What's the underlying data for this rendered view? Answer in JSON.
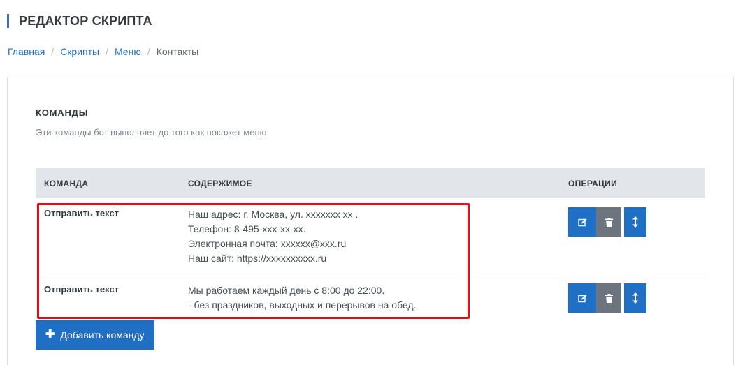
{
  "header": {
    "title": "РЕДАКТОР СКРИПТА"
  },
  "breadcrumb": {
    "items": [
      "Главная",
      "Скрипты",
      "Меню"
    ],
    "current": "Контакты",
    "separator": "/"
  },
  "section": {
    "title": "КОМАНДЫ",
    "description": "Эти команды бот выполняет до того как покажет меню."
  },
  "table": {
    "columns": {
      "command": "КОМАНДА",
      "content": "СОДЕРЖИМОЕ",
      "operations": "ОПЕРАЦИИ"
    },
    "rows": [
      {
        "command": "Отправить текст",
        "lines": [
          "Наш адрес: г. Москва, ул. xxxxxxx xx .",
          "Телефон: 8-495-xxx-xx-xx.",
          "Электронная почта: xxxxxx@xxx.ru",
          "Наш сайт: https://xxxxxxxxxx.ru"
        ]
      },
      {
        "command": "Отправить текст",
        "lines": [
          "Мы работаем каждый день с 8:00 до 22:00.",
          "- без праздников, выходных и перерывов на обед."
        ]
      }
    ],
    "operation_icons": [
      "edit-icon",
      "trash-icon",
      "move-vertical-icon"
    ]
  },
  "actions": {
    "add_label": "Добавить команду",
    "add_icon": "plus-icon"
  },
  "colors": {
    "primary": "#1f6fc5",
    "secondary": "#6c757d",
    "accent_bar": "#3f6ad8",
    "highlight": "#e0101a",
    "table_header": "#e2e5e9"
  }
}
